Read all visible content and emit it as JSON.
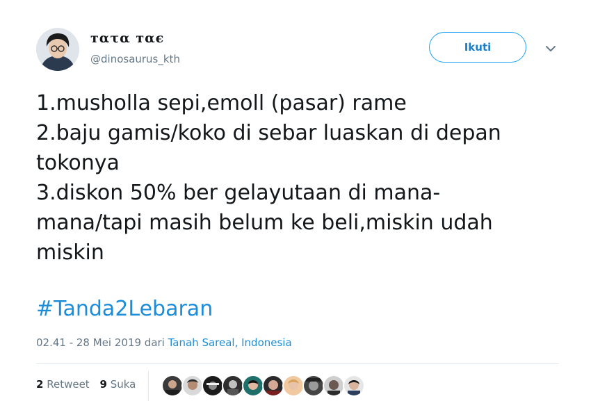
{
  "user": {
    "display_name": "тατα тαє",
    "handle": "@dinosaurus_kth"
  },
  "follow_button_label": "Ikuti",
  "menu_icon": "chevron-down-icon",
  "tweet": {
    "lines": [
      "1.musholla sepi,emoll (pasar) rame",
      "2.baju gamis/koko di sebar luaskan di depan",
      "tokonya",
      "3.diskon 50% ber gelayutaan di mana-",
      "mana/tapi masih belum ke beli,miskin udah",
      "miskin"
    ],
    "hashtag": "#Tanda2Lebaran"
  },
  "meta": {
    "timestamp": "02.41 - 28 Mei 2019 dari ",
    "location": "Tanah Sareal, Indonesia"
  },
  "stats": {
    "retweets_count": "2",
    "retweets_label": "Retweet",
    "likes_count": "9",
    "likes_label": "Suka"
  },
  "colors": {
    "accent": "#1da1f2",
    "link": "#1d8dd8",
    "text": "#14171a",
    "muted": "#657786",
    "divider": "#e1e8ed"
  }
}
